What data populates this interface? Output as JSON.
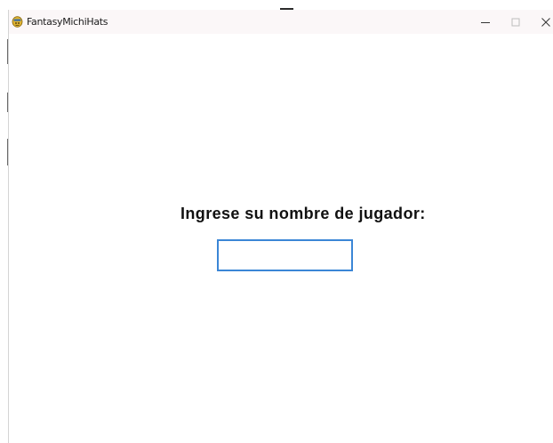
{
  "window": {
    "title": "FantasyMichiHats",
    "controls": {
      "minimize": "minimize-icon",
      "maximize": "maximize-icon",
      "close": "close-icon"
    }
  },
  "main": {
    "prompt": "Ingrese su nombre de jugador:",
    "name_input": {
      "value": ""
    }
  },
  "colors": {
    "titlebar": "#fbf7f8",
    "input_border": "#3b86d6",
    "text": "#111111"
  }
}
